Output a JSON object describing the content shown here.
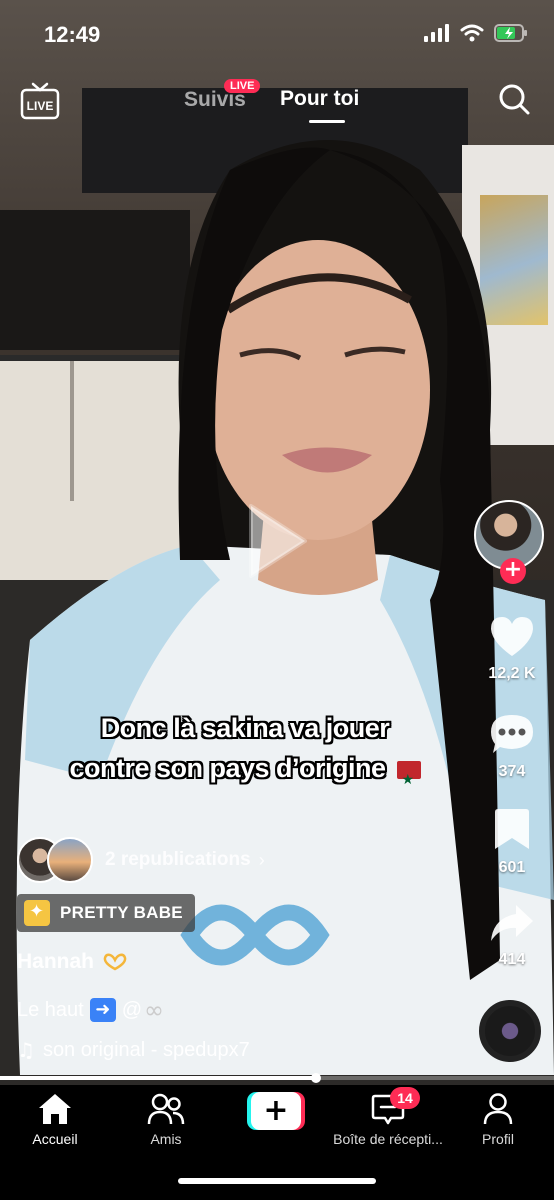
{
  "status_bar": {
    "time": "12:49"
  },
  "top_nav": {
    "tabs": [
      {
        "label": "Suivis",
        "badge": "LIVE",
        "active": false
      },
      {
        "label": "Pour toi",
        "active": true
      }
    ],
    "live_icon_label": "LIVE"
  },
  "video": {
    "overlay_caption_line1": "Donc là  sakina  va jouer",
    "overlay_caption_line2": "contre son pays d’origine",
    "progress_fraction": 0.57
  },
  "actions": {
    "likes": "12,2 K",
    "comments": "374",
    "saves": "601",
    "shares": "414"
  },
  "post": {
    "reposts_label": "2 republications",
    "chip_label": "PRETTY BABE",
    "author": "Hannah",
    "description_text": "Le haut",
    "description_mention": "@",
    "sound": "son original - spedupx7"
  },
  "tab_bar": {
    "tabs": [
      {
        "label": "Accueil",
        "icon": "home-icon"
      },
      {
        "label": "Amis",
        "icon": "friends-icon"
      },
      {
        "label": "",
        "icon": "create-plus-icon"
      },
      {
        "label": "Boîte de récepti...",
        "icon": "inbox-icon",
        "badge": "14"
      },
      {
        "label": "Profil",
        "icon": "profile-icon"
      }
    ]
  },
  "colors": {
    "accent_red": "#fe2c55",
    "accent_cyan": "#25f4ee"
  }
}
